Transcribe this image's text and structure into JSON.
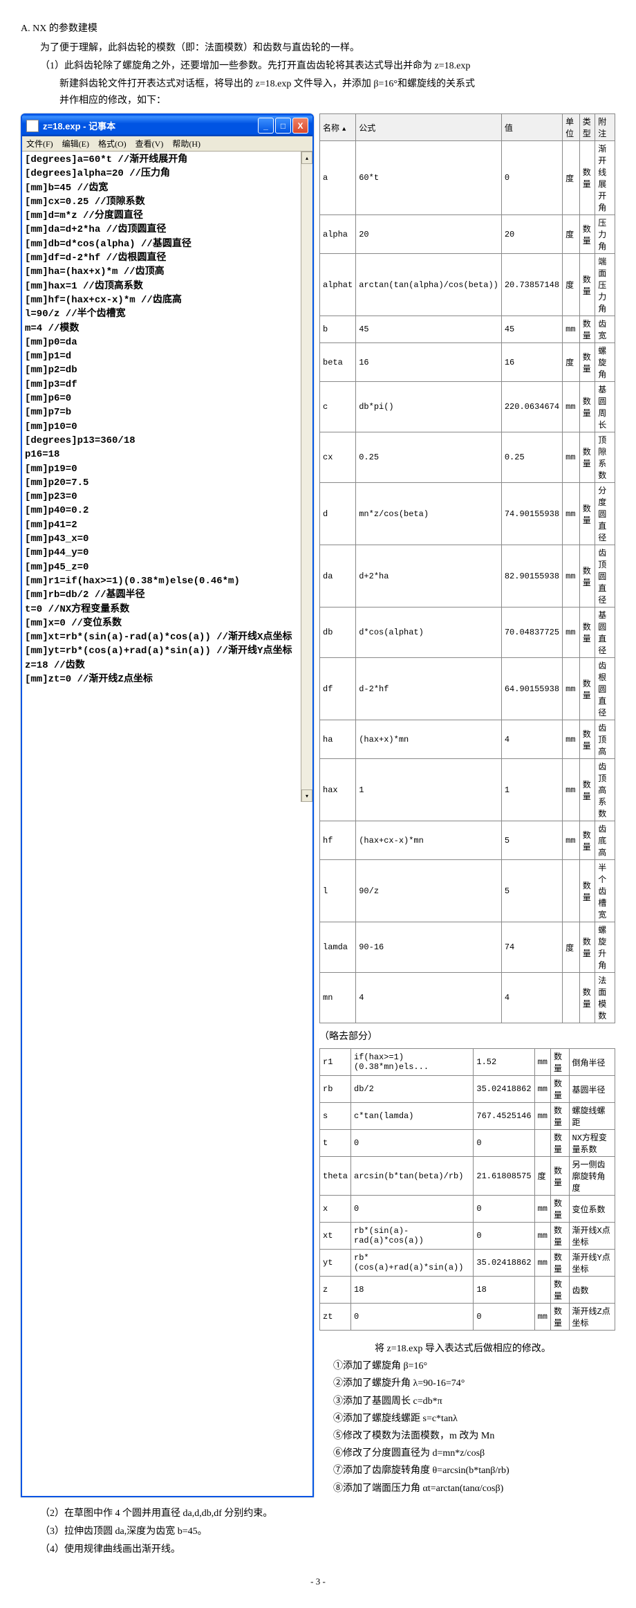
{
  "heading": "A. NX 的参数建模",
  "intro": "为了便于理解，此斜齿轮的模数（即：法面模数）和齿数与直齿轮的一样。",
  "step1_line1": "（1）此斜齿轮除了螺旋角之外，还要增加一些参数。先打开直齿齿轮将其表达式导出并命为 z=18.exp",
  "step1_line2": "新建斜齿轮文件打开表达式对话框，将导出的 z=18.exp 文件导入，并添加 β=16°和螺旋线的关系式",
  "step1_line3": "并作相应的修改，如下：",
  "notepad": {
    "title": "z=18.exp - 记事本",
    "menu_file": "文件(F)",
    "menu_edit": "编辑(E)",
    "menu_format": "格式(O)",
    "menu_view": "查看(V)",
    "menu_help": "帮助(H)",
    "lines": [
      "[degrees]a=60*t //渐开线展开角",
      "[degrees]alpha=20 //压力角",
      "[mm]b=45 //齿宽",
      "[mm]cx=0.25 //顶隙系数",
      "[mm]d=m*z //分度圆直径",
      "[mm]da=d+2*ha //齿顶圆直径",
      "[mm]db=d*cos(alpha) //基圆直径",
      "[mm]df=d-2*hf //齿根圆直径",
      "[mm]ha=(hax+x)*m //齿顶高",
      "[mm]hax=1 //齿顶高系数",
      "[mm]hf=(hax+cx-x)*m //齿底高",
      "l=90/z //半个齿槽宽",
      "m=4 //模数",
      "[mm]p0=da",
      "[mm]p1=d",
      "[mm]p2=db",
      "[mm]p3=df",
      "[mm]p6=0",
      "[mm]p7=b",
      "[mm]p10=0",
      "[degrees]p13=360/18",
      "p16=18",
      "[mm]p19=0",
      "[mm]p20=7.5",
      "[mm]p23=0",
      "[mm]p40=0.2",
      "[mm]p41=2",
      "[mm]p43_x=0",
      "[mm]p44_y=0",
      "[mm]p45_z=0",
      "[mm]r1=if(hax>=1)(0.38*m)else(0.46*m)",
      "[mm]rb=db/2 //基圆半径",
      "t=0 //NX方程变量系数",
      "[mm]x=0 //变位系数",
      "[mm]xt=rb*(sin(a)-rad(a)*cos(a)) //渐开线X点坐标",
      "[mm]yt=rb*(cos(a)+rad(a)*sin(a)) //渐开线Y点坐标",
      "z=18 //齿数",
      "[mm]zt=0 //渐开线Z点坐标"
    ]
  },
  "table1": {
    "headers": [
      "名称",
      "公式",
      "值",
      "单位",
      "类型",
      "附注"
    ],
    "rows": [
      [
        "a",
        "60*t",
        "0",
        "度",
        "数量",
        "渐开线展开角"
      ],
      [
        "alpha",
        "20",
        "20",
        "度",
        "数量",
        "压力角"
      ],
      [
        "alphat",
        "arctan(tan(alpha)/cos(beta))",
        "20.73857148",
        "度",
        "数量",
        "端面压力角"
      ],
      [
        "b",
        "45",
        "45",
        "mm",
        "数量",
        "齿宽"
      ],
      [
        "beta",
        "16",
        "16",
        "度",
        "数量",
        "螺旋角"
      ],
      [
        "c",
        "db*pi()",
        "220.0634674",
        "mm",
        "数量",
        "基圆周长"
      ],
      [
        "cx",
        "0.25",
        "0.25",
        "mm",
        "数量",
        "顶隙系数"
      ],
      [
        "d",
        "mn*z/cos(beta)",
        "74.90155938",
        "mm",
        "数量",
        "分度圆直径"
      ],
      [
        "da",
        "d+2*ha",
        "82.90155938",
        "mm",
        "数量",
        "齿顶圆直径"
      ],
      [
        "db",
        "d*cos(alphat)",
        "70.04837725",
        "mm",
        "数量",
        "基圆直径"
      ],
      [
        "df",
        "d-2*hf",
        "64.90155938",
        "mm",
        "数量",
        "齿根圆直径"
      ],
      [
        "ha",
        "(hax+x)*mn",
        "4",
        "mm",
        "数量",
        "齿顶高"
      ],
      [
        "hax",
        "1",
        "1",
        "mm",
        "数量",
        "齿顶高系数"
      ],
      [
        "hf",
        "(hax+cx-x)*mn",
        "5",
        "mm",
        "数量",
        "齿底高"
      ],
      [
        "l",
        "90/z",
        "5",
        "",
        "数量",
        "半个齿槽宽"
      ],
      [
        "lamda",
        "90-16",
        "74",
        "度",
        "数量",
        "螺旋升角"
      ],
      [
        "mn",
        "4",
        "4",
        "",
        "数量",
        "法面模数"
      ]
    ]
  },
  "omit": "（略去部分）",
  "table2": {
    "rows": [
      [
        "r1",
        "if(hax>=1)(0.38*mn)els...",
        "1.52",
        "mm",
        "数量",
        "倒角半径"
      ],
      [
        "rb",
        "db/2",
        "35.02418862",
        "mm",
        "数量",
        "基圆半径"
      ],
      [
        "s",
        "c*tan(lamda)",
        "767.4525146",
        "mm",
        "数量",
        "螺旋线螺距"
      ],
      [
        "t",
        "0",
        "0",
        "",
        "数量",
        "NX方程变量系数"
      ],
      [
        "theta",
        "arcsin(b*tan(beta)/rb)",
        "21.61808575",
        "度",
        "数量",
        "另一侧齿廓旋转角度"
      ],
      [
        "x",
        "0",
        "0",
        "mm",
        "数量",
        "变位系数"
      ],
      [
        "xt",
        "rb*(sin(a)-rad(a)*cos(a))",
        "0",
        "mm",
        "数量",
        "渐开线X点坐标"
      ],
      [
        "yt",
        "rb*(cos(a)+rad(a)*sin(a))",
        "35.02418862",
        "mm",
        "数量",
        "渐开线Y点坐标"
      ],
      [
        "z",
        "18",
        "18",
        "",
        "数量",
        "齿数"
      ],
      [
        "zt",
        "0",
        "0",
        "mm",
        "数量",
        "渐开线Z点坐标"
      ]
    ]
  },
  "notes_title": "将 z=18.exp 导入表达式后做相应的修改。",
  "notes": [
    "①添加了螺旋角 β=16°",
    "②添加了螺旋升角 λ=90-16=74°",
    "③添加了基圆周长 c=db*π",
    "④添加了螺旋线螺距 s=c*tanλ",
    "⑤修改了模数为法面模数，m 改为 Mn",
    "⑥修改了分度圆直径为 d=mn*z/cosβ",
    "⑦添加了齿廓旋转角度 θ=arcsin(b*tanβ/rb)",
    "⑧添加了端面压力角 αt=arctan(tanα/cosβ)"
  ],
  "step2": "（2）在草图中作 4 个圆并用直径 da,d,db,df 分别约束。",
  "step3": "（3）拉伸齿顶圆 da,深度为齿宽 b=45。",
  "step4": "（4）使用规律曲线画出渐开线。",
  "page_num": "- 3 -"
}
